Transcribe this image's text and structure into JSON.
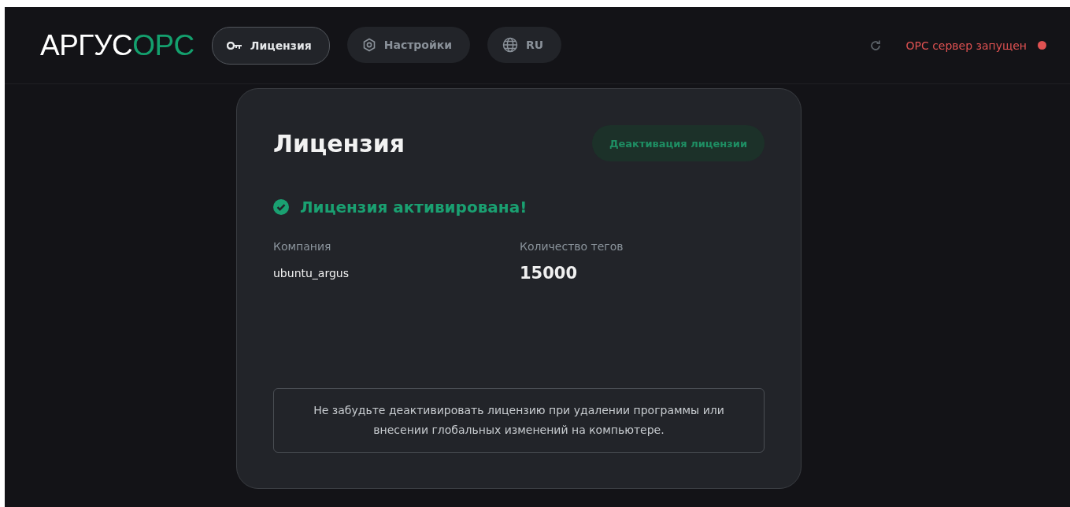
{
  "header": {
    "logo": {
      "main": "АРГУС",
      "accent": "OPC"
    },
    "nav": [
      {
        "kind": "key",
        "label": "Лицензия",
        "selected": true
      },
      {
        "kind": "settings",
        "label": "Настройки",
        "selected": false
      },
      {
        "kind": "globe",
        "label": "RU",
        "selected": false
      }
    ],
    "status": {
      "text": "OPC сервер запущен",
      "color": "#e05252"
    }
  },
  "license": {
    "title": "Лицензия",
    "deactivate_button": "Деактивация лицензии",
    "activated": true,
    "status_text": "Лицензия активирована!",
    "fields": [
      {
        "label": "Компания",
        "value": "ubuntu_argus",
        "kind": "text"
      },
      {
        "label": "Количество тегов",
        "value": "15000",
        "kind": "number"
      }
    ],
    "notice": "Не забудьте деактивировать лицензию при удалении программы или внесении глобальных изменений на компьютере."
  }
}
